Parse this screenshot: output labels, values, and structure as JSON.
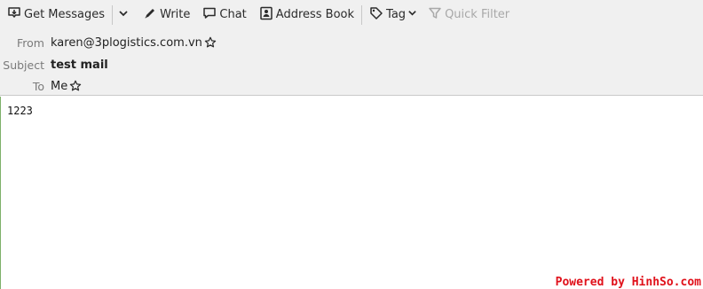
{
  "toolbar": {
    "get_messages": "Get Messages",
    "write": "Write",
    "chat": "Chat",
    "address_book": "Address Book",
    "tag": "Tag",
    "quick_filter": "Quick Filter"
  },
  "header": {
    "from_label": "From",
    "from_value": "karen@3plogistics.com.vn",
    "subject_label": "Subject",
    "subject_value": "test mail",
    "to_label": "To",
    "to_value": "Me"
  },
  "message": {
    "body": "1223"
  },
  "watermark": "Powered by HinhSo.com",
  "colors": {
    "toolbar_bg": "#f0f0f0",
    "body_border": "#7eb06a",
    "watermark": "#e0101a",
    "disabled_text": "#a8a8a8"
  },
  "icons": [
    "download-icon",
    "chevron-down-icon",
    "pencil-icon",
    "chat-bubble-icon",
    "address-book-icon",
    "tag-icon",
    "filter-icon",
    "star-icon"
  ]
}
